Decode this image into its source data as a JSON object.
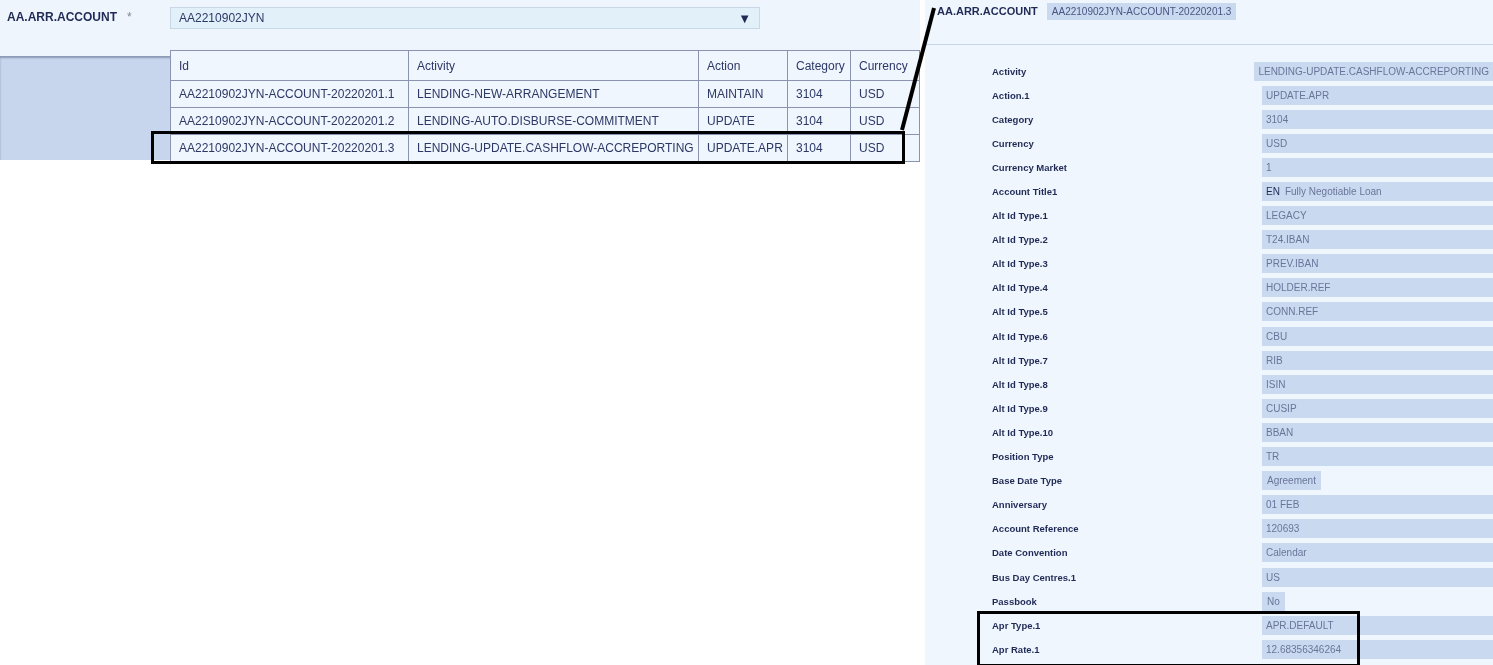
{
  "left": {
    "field": {
      "label": "AA.ARR.ACCOUNT",
      "required_mark": "*",
      "value": "AA2210902JYN",
      "dropdown_icon": "▼"
    },
    "table": {
      "columns": [
        "Id",
        "Activity",
        "Action",
        "Category",
        "Currency"
      ],
      "rows": [
        {
          "cells": [
            "AA2210902JYN-ACCOUNT-20220201.1",
            "LENDING-NEW-ARRANGEMENT",
            "MAINTAIN",
            "3104",
            "USD"
          ],
          "highlighted": false
        },
        {
          "cells": [
            "AA2210902JYN-ACCOUNT-20220201.2",
            "LENDING-AUTO.DISBURSE-COMMITMENT",
            "UPDATE",
            "3104",
            "USD"
          ],
          "highlighted": false
        },
        {
          "cells": [
            "AA2210902JYN-ACCOUNT-20220201.3",
            "LENDING-UPDATE.CASHFLOW-ACCREPORTING",
            "UPDATE.APR",
            "3104",
            "USD"
          ],
          "highlighted": true
        }
      ]
    }
  },
  "right": {
    "header": {
      "label": "AA.ARR.ACCOUNT",
      "value": "AA2210902JYN-ACCOUNT-20220201.3"
    },
    "fields": [
      {
        "label": "Activity",
        "value": "LENDING-UPDATE.CASHFLOW-ACCREPORTING",
        "kind": "full",
        "highlighted": false
      },
      {
        "label": "Action.1",
        "value": "UPDATE.APR",
        "kind": "full",
        "highlighted": false
      },
      {
        "label": "Category",
        "value": "3104",
        "kind": "full",
        "highlighted": false
      },
      {
        "label": "Currency",
        "value": "USD",
        "kind": "full",
        "highlighted": false
      },
      {
        "label": "Currency Market",
        "value": "1",
        "kind": "full",
        "highlighted": false
      },
      {
        "label": "Account Title1",
        "value": "Fully Negotiable Loan",
        "lang": "EN",
        "kind": "full",
        "highlighted": false
      },
      {
        "label": "Alt Id Type.1",
        "value": "LEGACY",
        "kind": "full",
        "highlighted": false
      },
      {
        "label": "Alt Id Type.2",
        "value": "T24.IBAN",
        "kind": "full",
        "highlighted": false
      },
      {
        "label": "Alt Id Type.3",
        "value": "PREV.IBAN",
        "kind": "full",
        "highlighted": false
      },
      {
        "label": "Alt Id Type.4",
        "value": "HOLDER.REF",
        "kind": "full",
        "highlighted": false
      },
      {
        "label": "Alt Id Type.5",
        "value": "CONN.REF",
        "kind": "full",
        "highlighted": false
      },
      {
        "label": "Alt Id Type.6",
        "value": "CBU",
        "kind": "full",
        "highlighted": false
      },
      {
        "label": "Alt Id Type.7",
        "value": "RIB",
        "kind": "full",
        "highlighted": false
      },
      {
        "label": "Alt Id Type.8",
        "value": "ISIN",
        "kind": "full",
        "highlighted": false
      },
      {
        "label": "Alt Id Type.9",
        "value": "CUSIP",
        "kind": "full",
        "highlighted": false
      },
      {
        "label": "Alt Id Type.10",
        "value": "BBAN",
        "kind": "full",
        "highlighted": false
      },
      {
        "label": "Position Type",
        "value": "TR",
        "kind": "full",
        "highlighted": false
      },
      {
        "label": "Base Date Type",
        "value": "Agreement",
        "kind": "compact",
        "highlighted": false
      },
      {
        "label": "Anniversary",
        "value": "01 FEB",
        "kind": "full",
        "highlighted": false
      },
      {
        "label": "Account Reference",
        "value": "120693",
        "kind": "full",
        "highlighted": false
      },
      {
        "label": "Date Convention",
        "value": "Calendar",
        "kind": "full",
        "highlighted": false
      },
      {
        "label": "Bus Day Centres.1",
        "value": "US",
        "kind": "full",
        "highlighted": false
      },
      {
        "label": "Passbook",
        "value": "No",
        "kind": "compact",
        "highlighted": false
      },
      {
        "label": "Apr Type.1",
        "value": "APR.DEFAULT",
        "kind": "full",
        "highlighted": true
      },
      {
        "label": "Apr Rate.1",
        "value": "12.68356346264",
        "kind": "full",
        "highlighted": true
      }
    ]
  }
}
